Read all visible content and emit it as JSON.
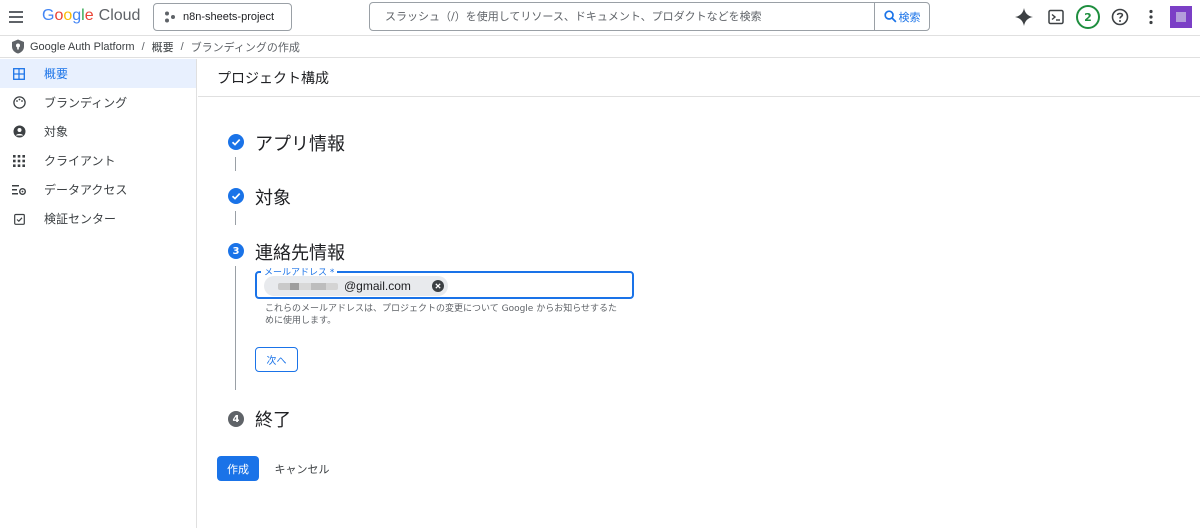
{
  "topbar": {
    "logo": {
      "google": "Google",
      "cloud": "Cloud"
    },
    "project": "n8n-sheets-project",
    "search": {
      "placeholder": "スラッシュ（/）を使用してリソース、ドキュメント、プロダクトなどを検索",
      "button": "検索"
    },
    "notification_count": "2"
  },
  "breadcrumb": [
    "Google Auth Platform",
    "概要",
    "ブランディングの作成"
  ],
  "sidebar": {
    "items": [
      {
        "label": "概要",
        "icon": "dashboard-icon",
        "active": true
      },
      {
        "label": "ブランディング",
        "icon": "palette-icon",
        "active": false
      },
      {
        "label": "対象",
        "icon": "account-circle-icon",
        "active": false
      },
      {
        "label": "クライアント",
        "icon": "apps-grid-icon",
        "active": false
      },
      {
        "label": "データアクセス",
        "icon": "data-settings-icon",
        "active": false
      },
      {
        "label": "検証センター",
        "icon": "checklist-icon",
        "active": false
      }
    ]
  },
  "page": {
    "title": "プロジェクト構成",
    "steps": [
      {
        "title": "アプリ情報",
        "status": "done"
      },
      {
        "title": "対象",
        "status": "done"
      },
      {
        "number": "3",
        "title": "連絡先情報",
        "status": "current"
      },
      {
        "number": "4",
        "title": "終了",
        "status": "todo"
      }
    ],
    "contact": {
      "label": "メールアドレス *",
      "email_visible": "@gmail.com",
      "helper": "これらのメールアドレスは、プロジェクトの変更について Google からお知らせするために使用します。",
      "next": "次へ"
    },
    "create": "作成",
    "cancel": "キャンセル"
  }
}
